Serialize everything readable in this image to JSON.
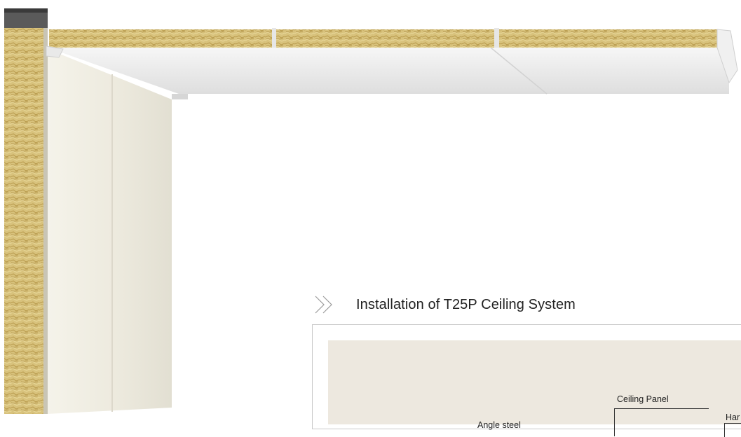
{
  "section": {
    "title": "Installation of T25P Ceiling System",
    "icon": "double-chevron-right-icon"
  },
  "diagram": {
    "labels": {
      "ceiling_panel": "Ceiling Panel",
      "angle_steel": "Angle steel",
      "hanger_partial": "Har"
    }
  },
  "colors": {
    "rockwool": "#d9c27a",
    "panel_face": "#eeece4",
    "ceiling_face": "#ebebeb",
    "diagram_bg": "#ede8df",
    "frame_border": "#c9c9c9"
  }
}
